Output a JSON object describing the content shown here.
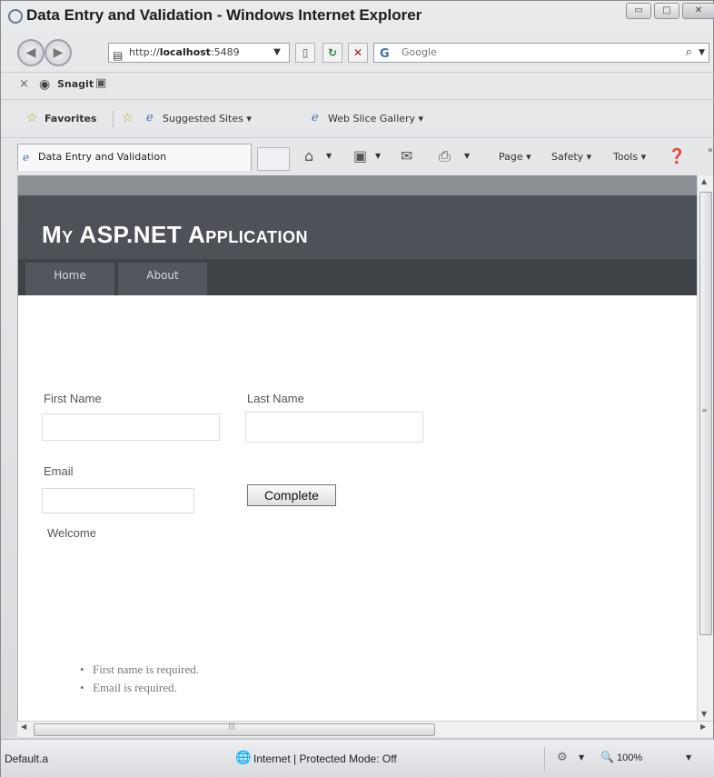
{
  "window": {
    "title": "Data Entry and Validation - Windows Internet Explorer",
    "min_glyph": "▭",
    "max_glyph": "□",
    "close_glyph": "✕"
  },
  "address": {
    "url_prefix": "http://",
    "url_host": "localhost",
    "url_rest": ":5489",
    "search_placeholder": "Google",
    "search_logo": "G"
  },
  "snagit": {
    "close": "×",
    "label": "Snagit"
  },
  "favorites": {
    "label": "Favorites",
    "suggested_sites": "Suggested Sites ▾",
    "web_slice_gallery": "Web Slice Gallery ▾"
  },
  "tab": {
    "label": "Data Entry and Validation"
  },
  "commands": {
    "page": "Page ▾",
    "safety": "Safety ▾",
    "tools": "Tools ▾"
  },
  "site": {
    "title": "My ASP.NET Application",
    "nav": [
      "Home",
      "About"
    ]
  },
  "form": {
    "first_name_label": "First Name",
    "last_name_label": "Last Name",
    "email_label": "Email",
    "complete_button": "Complete",
    "welcome_text": "Welcome",
    "errors": [
      "First name is required.",
      "Email is required."
    ]
  },
  "status": {
    "text": "Default.a",
    "zone": "Internet | Protected Mode: Off",
    "zoom": "100%"
  }
}
